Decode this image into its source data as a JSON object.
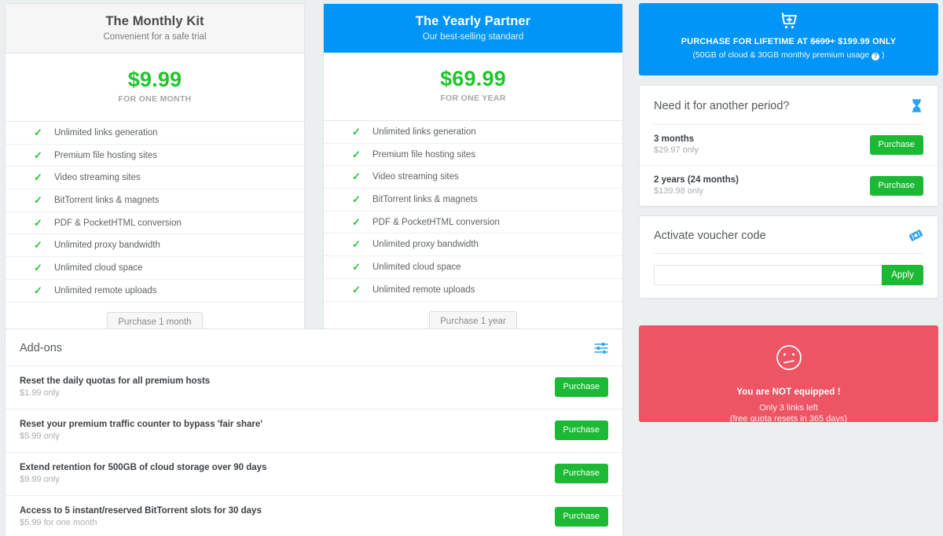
{
  "plans": [
    {
      "id": "monthly",
      "title": "The Monthly Kit",
      "subtitle": "Convenient for a safe trial",
      "price": "$9.99",
      "period": "FOR ONE MONTH",
      "cta": "Purchase 1 month",
      "features": [
        "Unlimited links generation",
        "Premium file hosting sites",
        "Video streaming sites",
        "BitTorrent links & magnets",
        "PDF & PocketHTML conversion",
        "Unlimited proxy bandwidth",
        "Unlimited cloud space",
        "Unlimited remote uploads"
      ]
    },
    {
      "id": "yearly",
      "title": "The Yearly Partner",
      "subtitle": "Our best-selling standard",
      "price": "$69.99",
      "period": "FOR ONE YEAR",
      "cta": "Purchase 1 year",
      "features": [
        "Unlimited links generation",
        "Premium file hosting sites",
        "Video streaming sites",
        "BitTorrent links & magnets",
        "PDF & PocketHTML conversion",
        "Unlimited proxy bandwidth",
        "Unlimited cloud space",
        "Unlimited remote uploads"
      ]
    }
  ],
  "lifetime": {
    "icon": "cart-plus-icon",
    "headline_prefix": "PURCHASE FOR LIFETIME AT ",
    "old_price": "$699+",
    "new_price": " $199.99 ONLY",
    "sub_prefix": "(50GB of cloud & 30GB monthly premium usage ",
    "sub_suffix": " )",
    "help_glyph": "?",
    "background_color": "#0195f7"
  },
  "period_panel": {
    "title": "Need it for another period?",
    "icon": "hourglass-icon",
    "icon_color": "#29a3f5",
    "options": [
      {
        "name": "3 months",
        "price": "$29.97 only",
        "button": "Purchase"
      },
      {
        "name": "2 years (24 months)",
        "price": "$139.98 only",
        "button": "Purchase"
      }
    ]
  },
  "voucher_panel": {
    "title": "Activate voucher code",
    "icon": "voucher-ticket-icon",
    "icon_color": "#29a3f5",
    "input_value": "",
    "input_placeholder": "",
    "button": "Apply"
  },
  "status": {
    "icon": "confused-face-icon",
    "title": "You are NOT equipped !",
    "line1": "Only 3 links left",
    "line2": "(free quota resets in 365 days)",
    "background_color": "#ed5565"
  },
  "addons": {
    "title": "Add-ons",
    "icon": "sliders-icon",
    "icon_color": "#29a3f5",
    "items": [
      {
        "name": "Reset the daily quotas for all premium hosts",
        "price": "$1.99 only",
        "button": "Purchase"
      },
      {
        "name": "Reset your premium traffic counter to bypass 'fair share'",
        "price": "$5.99 only",
        "button": "Purchase"
      },
      {
        "name": "Extend retention for 500GB of cloud storage over 90 days",
        "price": "$9.99 only",
        "button": "Purchase"
      },
      {
        "name": "Access to 5 instant/reserved BitTorrent slots for 30 days",
        "price": "$5.99 for one month",
        "button": "Purchase"
      }
    ]
  },
  "colors": {
    "accent_blue": "#0195f7",
    "green": "#1bb934",
    "price_green": "#1fc52b",
    "red": "#ed5565",
    "page_bg": "#eceff0"
  }
}
